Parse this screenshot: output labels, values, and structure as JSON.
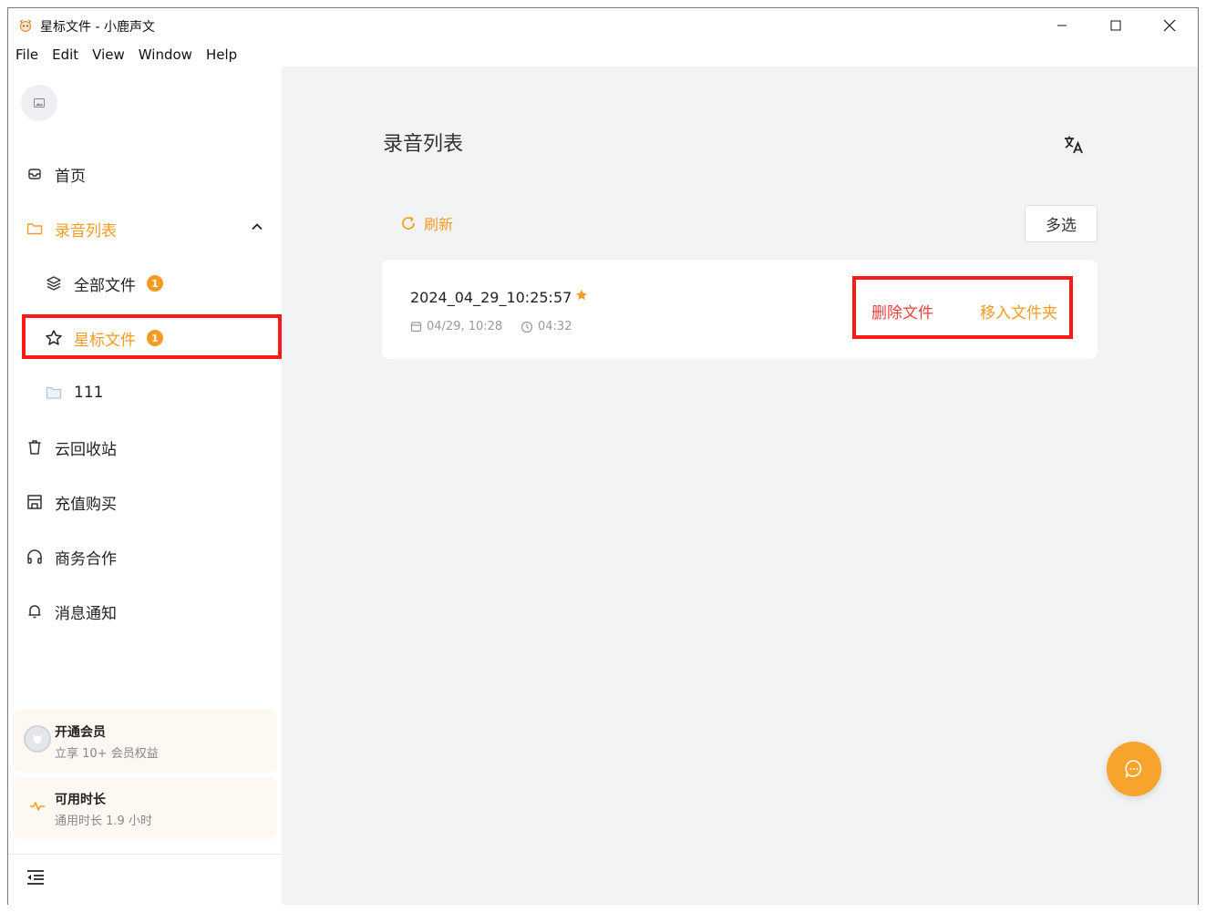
{
  "window": {
    "title": "星标文件 - 小鹿声文"
  },
  "menu": [
    "File",
    "Edit",
    "View",
    "Window",
    "Help"
  ],
  "sidebar": {
    "items": [
      {
        "label": "首页",
        "icon": "home-icon"
      },
      {
        "label": "录音列表",
        "icon": "folder-icon",
        "expanded": true
      },
      {
        "label": "全部文件",
        "icon": "layers-icon",
        "badge": "1"
      },
      {
        "label": "星标文件",
        "icon": "star-outline-icon",
        "badge": "1",
        "selected": true
      },
      {
        "label": "111",
        "icon": "folder-icon"
      },
      {
        "label": "云回收站",
        "icon": "trash-icon"
      },
      {
        "label": "充值购买",
        "icon": "store-icon"
      },
      {
        "label": "商务合作",
        "icon": "headphones-icon"
      },
      {
        "label": "消息通知",
        "icon": "bell-icon"
      }
    ],
    "promo_vip": {
      "title": "开通会员",
      "subtitle": "立享 10+ 会员权益"
    },
    "promo_time": {
      "title": "可用时长",
      "subtitle": "通用时长 1.9 小时"
    }
  },
  "main": {
    "title": "录音列表",
    "refresh_label": "刷新",
    "multi_select_label": "多选",
    "files": [
      {
        "name": "2024_04_29_10:25:57",
        "starred": true,
        "date": "04/29, 10:28",
        "duration": "04:32",
        "delete_label": "删除文件",
        "move_label": "移入文件夹"
      }
    ]
  },
  "colors": {
    "accent": "#f59a23",
    "danger": "#f04040",
    "highlight": "#ff1a1a",
    "main_bg": "#f2f3f5"
  }
}
